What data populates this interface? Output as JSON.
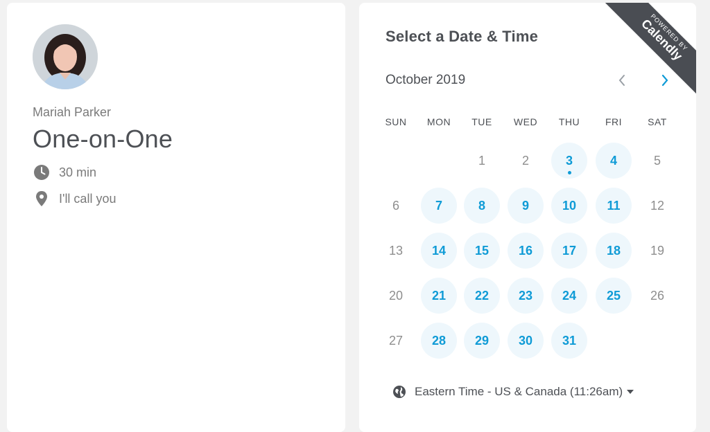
{
  "host": {
    "name": "Mariah Parker"
  },
  "event": {
    "title": "One-on-One",
    "duration": "30 min",
    "location": "I'll call you"
  },
  "calendar": {
    "heading": "Select a Date & Time",
    "month": "October 2019",
    "weekdays": [
      "SUN",
      "MON",
      "TUE",
      "WED",
      "THU",
      "FRI",
      "SAT"
    ],
    "weeks": [
      [
        null,
        null,
        {
          "d": "1",
          "a": false
        },
        {
          "d": "2",
          "a": false
        },
        {
          "d": "3",
          "a": true,
          "today": true
        },
        {
          "d": "4",
          "a": true
        },
        {
          "d": "5",
          "a": false
        }
      ],
      [
        {
          "d": "6",
          "a": false
        },
        {
          "d": "7",
          "a": true
        },
        {
          "d": "8",
          "a": true
        },
        {
          "d": "9",
          "a": true
        },
        {
          "d": "10",
          "a": true
        },
        {
          "d": "11",
          "a": true
        },
        {
          "d": "12",
          "a": false
        }
      ],
      [
        {
          "d": "13",
          "a": false
        },
        {
          "d": "14",
          "a": true
        },
        {
          "d": "15",
          "a": true
        },
        {
          "d": "16",
          "a": true
        },
        {
          "d": "17",
          "a": true
        },
        {
          "d": "18",
          "a": true
        },
        {
          "d": "19",
          "a": false
        }
      ],
      [
        {
          "d": "20",
          "a": false
        },
        {
          "d": "21",
          "a": true
        },
        {
          "d": "22",
          "a": true
        },
        {
          "d": "23",
          "a": true
        },
        {
          "d": "24",
          "a": true
        },
        {
          "d": "25",
          "a": true
        },
        {
          "d": "26",
          "a": false
        }
      ],
      [
        {
          "d": "27",
          "a": false
        },
        {
          "d": "28",
          "a": true
        },
        {
          "d": "29",
          "a": true
        },
        {
          "d": "30",
          "a": true
        },
        {
          "d": "31",
          "a": true
        },
        null,
        null
      ]
    ]
  },
  "timezone": {
    "label": "Eastern Time - US & Canada (11:26am)"
  },
  "badge": {
    "powered_by": "POWERED BY",
    "brand": "Calendly"
  },
  "colors": {
    "accent": "#0f9bd6",
    "available_bg": "#eef7fc",
    "ribbon": "#4a4d53"
  },
  "icons": {
    "duration": "clock-icon",
    "location": "map-pin-icon",
    "prev": "chevron-left-icon",
    "next": "chevron-right-icon",
    "timezone": "globe-icon",
    "tz_caret": "caret-down-icon"
  }
}
